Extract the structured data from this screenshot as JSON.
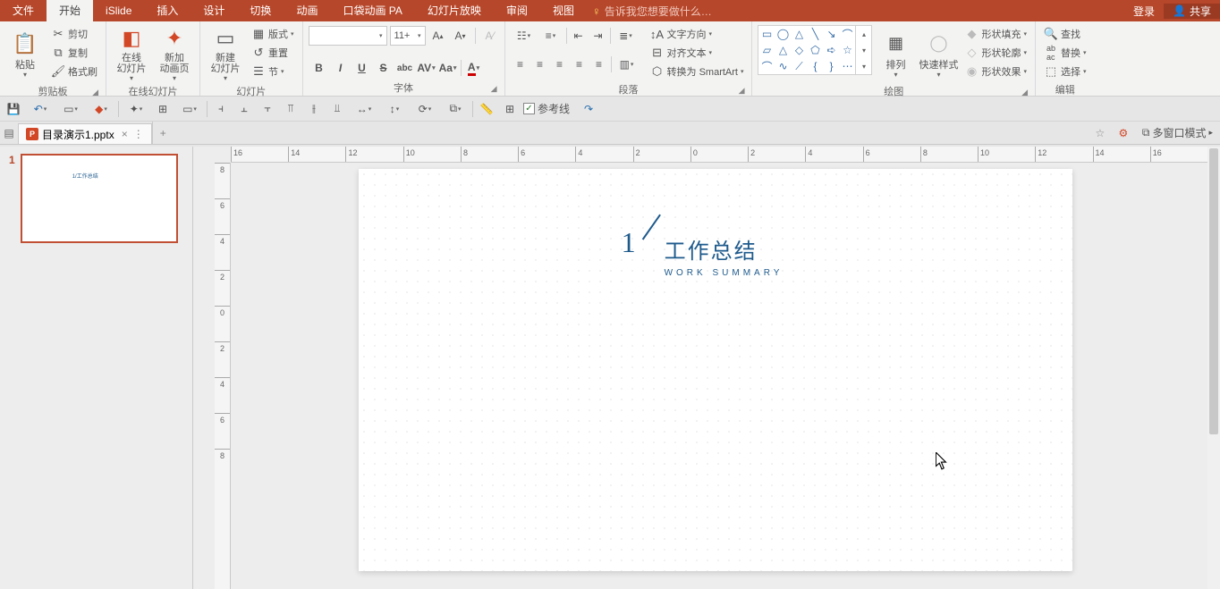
{
  "menubar": {
    "file": "文件",
    "home": "开始",
    "islide": "iSlide",
    "insert": "插入",
    "design": "设计",
    "transition": "切换",
    "animation": "动画",
    "pocket_anim": "口袋动画 PA",
    "slideshow": "幻灯片放映",
    "review": "审阅",
    "view": "视图",
    "tellme": "告诉我您想要做什么…",
    "login": "登录",
    "share": "共享"
  },
  "ribbon": {
    "clipboard": {
      "paste": "粘贴",
      "cut": "剪切",
      "copy": "复制",
      "format_painter": "格式刷",
      "label": "剪贴板"
    },
    "online_slides": {
      "online": "在线\n幻灯片",
      "new_anim": "新加\n动画页",
      "label": "在线幻灯片"
    },
    "slides": {
      "new_slide": "新建\n幻灯片",
      "layout": "版式",
      "reset": "重置",
      "section": "节",
      "label": "幻灯片"
    },
    "font": {
      "name_placeholder": "",
      "size": "11+",
      "label": "字体"
    },
    "paragraph": {
      "text_dir": "文字方向",
      "align_text": "对齐文本",
      "smartart": "转换为 SmartArt",
      "label": "段落"
    },
    "drawing": {
      "arrange": "排列",
      "quick_styles": "快速样式",
      "shape_fill": "形状填充",
      "shape_outline": "形状轮廓",
      "shape_effects": "形状效果",
      "label": "绘图"
    },
    "editing": {
      "find": "查找",
      "replace": "替换",
      "select": "选择",
      "label": "编辑"
    }
  },
  "qat": {
    "guides_label": "参考线"
  },
  "tabstrip": {
    "filename": "目录演示1.pptx",
    "multiwindow": "多窗口模式"
  },
  "thumbnail": {
    "num": "1"
  },
  "slide": {
    "num": "1",
    "title": "工作总结",
    "subtitle": "WORK SUMMARY"
  },
  "ruler": {
    "h": [
      "16",
      "14",
      "12",
      "10",
      "8",
      "6",
      "4",
      "2",
      "0",
      "2",
      "4",
      "6",
      "8",
      "10",
      "12",
      "14",
      "16"
    ],
    "v": [
      "8",
      "6",
      "4",
      "2",
      "0",
      "2",
      "4",
      "6",
      "8"
    ]
  }
}
